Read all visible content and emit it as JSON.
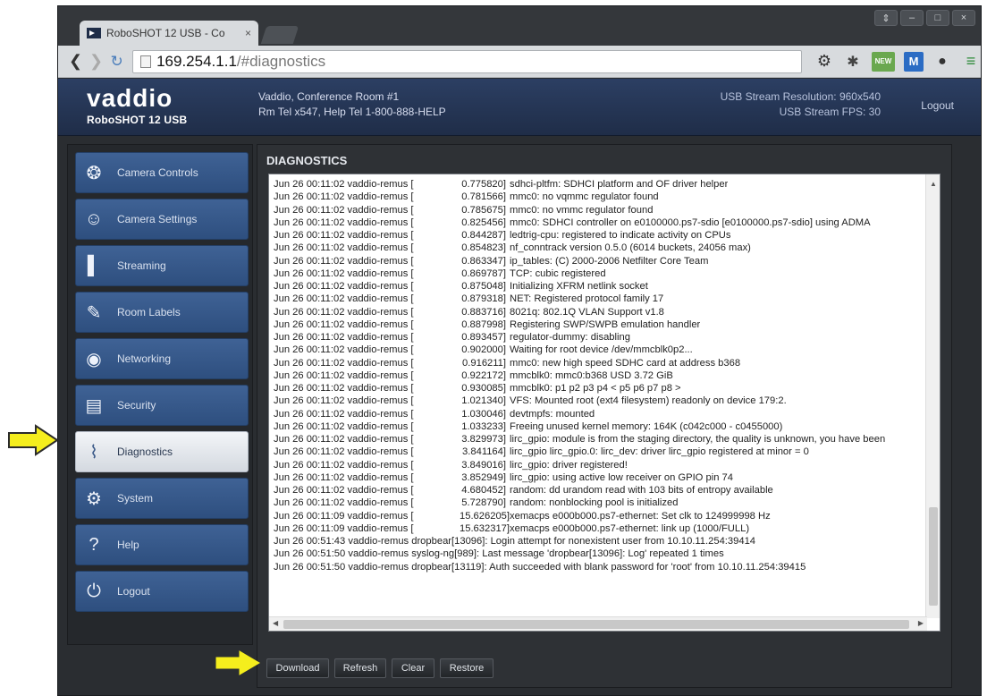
{
  "browser": {
    "tab_title": "RoboSHOT 12 USB - Co",
    "tab_close": "×",
    "url_host": "169.254.1.1",
    "url_path": "/#diagnostics",
    "window_controls": [
      "⇕",
      "–",
      "□",
      "×"
    ],
    "ext_new_label": "NEW",
    "ext_m_label": "M"
  },
  "header": {
    "logo": "vaddio",
    "model": "RoboSHOT 12 USB",
    "room": "Vaddio, Conference Room #1",
    "contact": "Rm Tel x547, Help Tel 1-800-888-HELP",
    "stream_resolution": "USB Stream Resolution: 960x540",
    "stream_fps": "USB Stream FPS: 30",
    "logout": "Logout"
  },
  "sidebar": {
    "items": [
      {
        "label": "Camera Controls",
        "icon": "joystick-icon"
      },
      {
        "label": "Camera Settings",
        "icon": "camera-settings-icon"
      },
      {
        "label": "Streaming",
        "icon": "streaming-icon"
      },
      {
        "label": "Room Labels",
        "icon": "room-labels-icon"
      },
      {
        "label": "Networking",
        "icon": "networking-icon"
      },
      {
        "label": "Security",
        "icon": "lock-icon"
      },
      {
        "label": "Diagnostics",
        "icon": "diagnostics-icon",
        "active": true
      },
      {
        "label": "System",
        "icon": "system-icon"
      },
      {
        "label": "Help",
        "icon": "help-icon"
      },
      {
        "label": "Logout",
        "icon": "power-icon"
      }
    ]
  },
  "main": {
    "title": "DIAGNOSTICS",
    "log_prefix": "Jun 26 00:11:02 vaddio-remus [",
    "log_lines": [
      {
        "ts": "0.775820]",
        "msg": "sdhci-pltfm: SDHCI platform and OF driver helper"
      },
      {
        "ts": "0.781566]",
        "msg": "mmc0: no vqmmc regulator found"
      },
      {
        "ts": "0.785675]",
        "msg": "mmc0: no vmmc regulator found"
      },
      {
        "ts": "0.825456]",
        "msg": "mmc0: SDHCI controller on e0100000.ps7-sdio [e0100000.ps7-sdio] using ADMA"
      },
      {
        "ts": "0.844287]",
        "msg": "ledtrig-cpu: registered to indicate activity on CPUs"
      },
      {
        "ts": "0.854823]",
        "msg": "nf_conntrack version 0.5.0 (6014 buckets, 24056 max)"
      },
      {
        "ts": "0.863347]",
        "msg": "ip_tables: (C) 2000-2006 Netfilter Core Team"
      },
      {
        "ts": "0.869787]",
        "msg": "TCP: cubic registered"
      },
      {
        "ts": "0.875048]",
        "msg": "Initializing XFRM netlink socket"
      },
      {
        "ts": "0.879318]",
        "msg": "NET: Registered protocol family 17"
      },
      {
        "ts": "0.883716]",
        "msg": "8021q: 802.1Q VLAN Support v1.8"
      },
      {
        "ts": "0.887998]",
        "msg": "Registering SWP/SWPB emulation handler"
      },
      {
        "ts": "0.893457]",
        "msg": "regulator-dummy: disabling"
      },
      {
        "ts": "0.902000]",
        "msg": "Waiting for root device /dev/mmcblk0p2..."
      },
      {
        "ts": "0.916211]",
        "msg": "mmc0: new high speed SDHC card at address b368"
      },
      {
        "ts": "0.922172]",
        "msg": "mmcblk0: mmc0:b368 USD  3.72 GiB"
      },
      {
        "ts": "0.930085]",
        "msg": " mmcblk0: p1 p2 p3 p4 < p5 p6 p7 p8 >"
      },
      {
        "ts": "1.021340]",
        "msg": "VFS: Mounted root (ext4 filesystem) readonly on device 179:2."
      },
      {
        "ts": "1.030046]",
        "msg": "devtmpfs: mounted"
      },
      {
        "ts": "1.033233]",
        "msg": "Freeing unused kernel memory: 164K (c042c000 - c0455000)"
      },
      {
        "ts": "3.829973]",
        "msg": "lirc_gpio: module is from the staging directory, the quality is unknown, you have been"
      },
      {
        "ts": "3.841164]",
        "msg": "lirc_gpio lirc_gpio.0: lirc_dev: driver lirc_gpio registered at minor = 0"
      },
      {
        "ts": "3.849016]",
        "msg": "lirc_gpio: driver registered!"
      },
      {
        "ts": "3.852949]",
        "msg": "lirc_gpio: using active low receiver on GPIO pin 74"
      },
      {
        "ts": "4.680452]",
        "msg": "random: dd urandom read with 103 bits of entropy available"
      },
      {
        "ts": "5.728790]",
        "msg": "random: nonblocking pool is initialized"
      }
    ],
    "log_lines_09": [
      {
        "ts": "15.626205]",
        "msg": "xemacps e000b000.ps7-ethernet: Set clk to 124999998 Hz"
      },
      {
        "ts": "15.632317]",
        "msg": "xemacps e000b000.ps7-ethernet: link up (1000/FULL)"
      }
    ],
    "log_prefix_09": "Jun 26 00:11:09 vaddio-remus [",
    "log_tail": [
      "Jun 26 00:51:43 vaddio-remus dropbear[13096]: Login attempt for nonexistent user from 10.10.11.254:39414",
      "Jun 26 00:51:50 vaddio-remus syslog-ng[989]: Last message 'dropbear[13096]: Log' repeated 1 times",
      "Jun 26 00:51:50 vaddio-remus dropbear[13119]: Auth succeeded with blank password for 'root' from 10.10.11.254:39415"
    ],
    "buttons": {
      "download": "Download",
      "refresh": "Refresh",
      "clear": "Clear",
      "restore": "Restore"
    }
  },
  "colors": {
    "header_bg": "#2c3f63",
    "nav_item_bg": "#3f6295",
    "annotation_arrow": "#f5ee1d"
  }
}
